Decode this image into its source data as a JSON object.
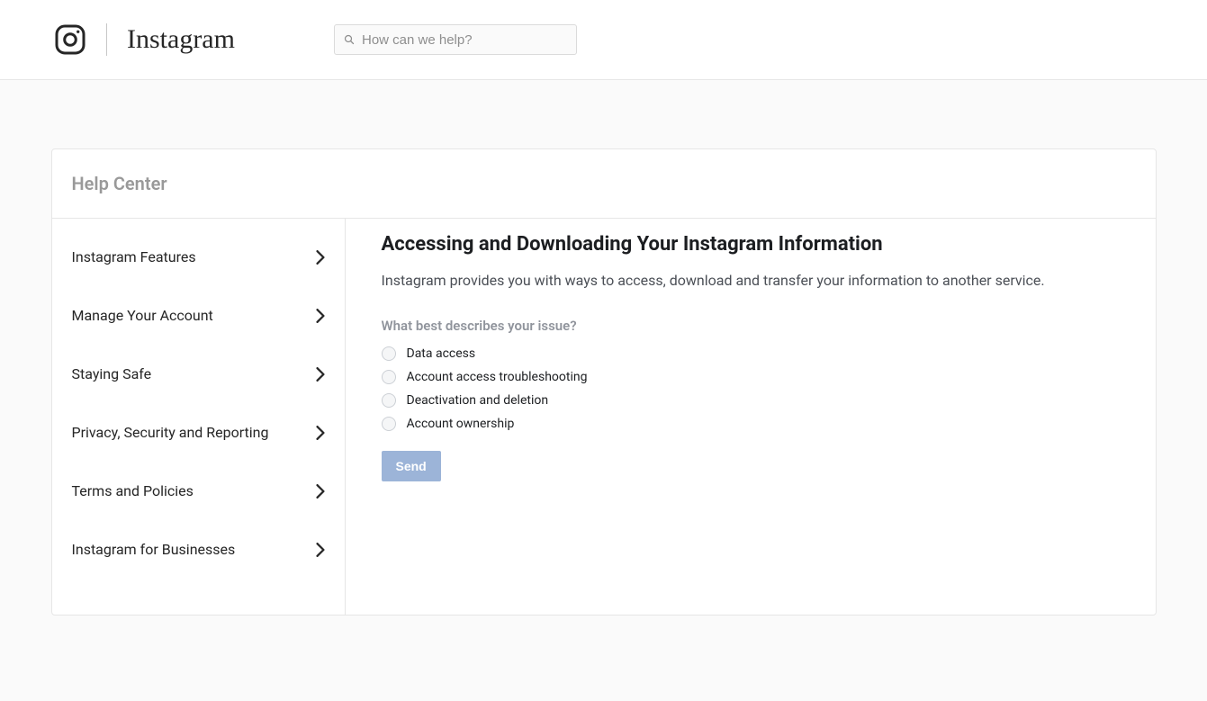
{
  "header": {
    "brand": "Instagram",
    "search_placeholder": "How can we help?"
  },
  "help_center": {
    "title": "Help Center",
    "nav": [
      {
        "label": "Instagram Features"
      },
      {
        "label": "Manage Your Account"
      },
      {
        "label": "Staying Safe"
      },
      {
        "label": "Privacy, Security and Reporting"
      },
      {
        "label": "Terms and Policies"
      },
      {
        "label": "Instagram for Businesses"
      }
    ]
  },
  "article": {
    "title": "Accessing and Downloading Your Instagram Information",
    "lead": "Instagram provides you with ways to access, download and transfer your information to another service.",
    "question": "What best describes your issue?",
    "options": [
      "Data access",
      "Account access troubleshooting",
      "Deactivation and deletion",
      "Account ownership"
    ],
    "send_label": "Send"
  }
}
